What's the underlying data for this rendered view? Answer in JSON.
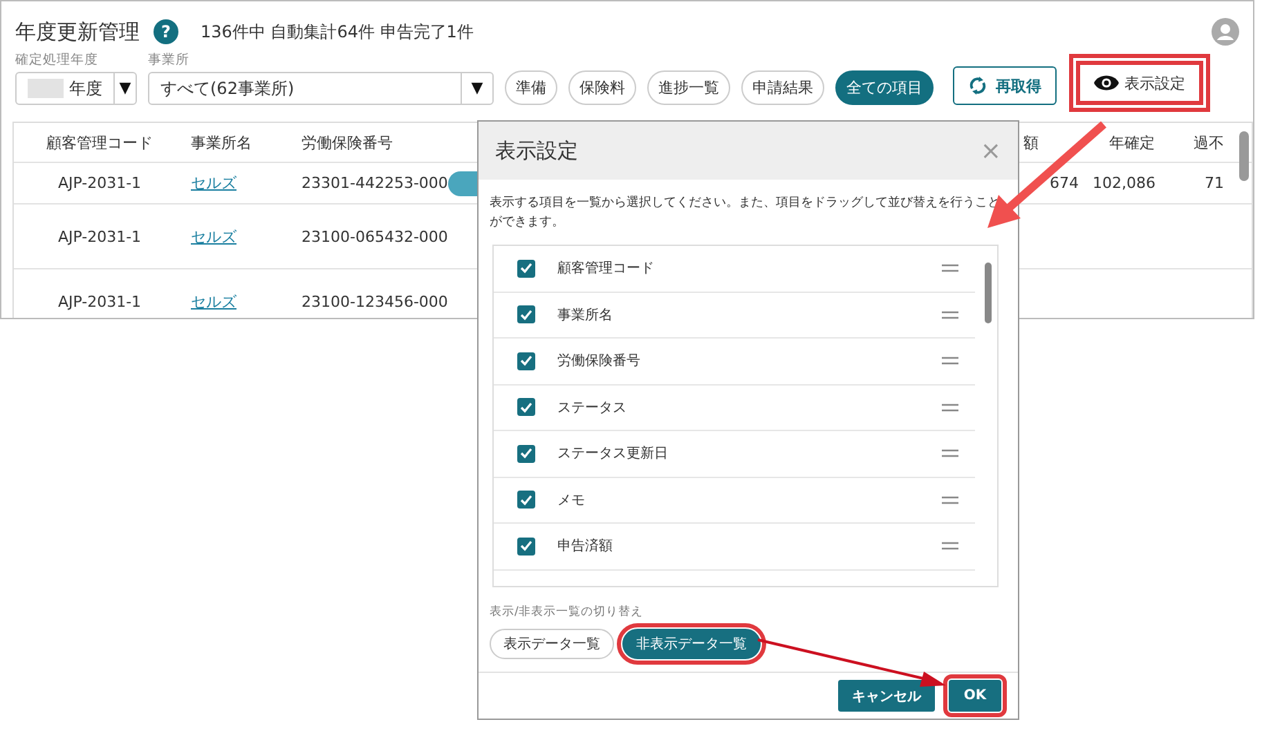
{
  "page": {
    "title": "年度更新管理",
    "help_icon": "?",
    "summary": "136件中 自動集計64件 申告完了1件"
  },
  "filters": [
    {
      "label": "確定処理年度",
      "value": "年度",
      "arrow": "▼",
      "redacted": true
    },
    {
      "label": "事業所",
      "value": "すべて(62事業所)",
      "arrow": "▼",
      "redacted": false
    }
  ],
  "view_buttons": [
    {
      "label": "準備",
      "selected": false
    },
    {
      "label": "保険料",
      "selected": false
    },
    {
      "label": "進捗一覧",
      "selected": false
    },
    {
      "label": "申請結果",
      "selected": false
    },
    {
      "label": "全ての項目",
      "selected": true
    }
  ],
  "reload_button": {
    "label": "再取得",
    "highlighted": false
  },
  "settings_button": {
    "label": "表示設定",
    "highlighted": true
  },
  "table": {
    "columns": [
      "顧客管理コード",
      "事業所名",
      "労働保険番号"
    ],
    "right_columns": [
      "額",
      "年確定",
      "過不"
    ],
    "rows": [
      {
        "cells": [
          "AJP-2031-1",
          "セルズ",
          "23301-442253-000"
        ],
        "status_pill": true,
        "right_cells": [
          "674",
          "102,086",
          "71"
        ]
      },
      {
        "cells": [
          "AJP-2031-1",
          "セルズ",
          "23100-065432-000"
        ],
        "status_pill": false,
        "right_cells": []
      },
      {
        "cells": [
          "AJP-2031-1",
          "セルズ",
          "23100-123456-000"
        ],
        "status_pill": false,
        "right_cells": []
      }
    ]
  },
  "dialog": {
    "title": "表示設定",
    "close": "×",
    "description": "表示する項目を一覧から選択してください。また、項目をドラッグして並び替えを行うことができます。",
    "items": [
      {
        "label": "顧客管理コード",
        "checked": true
      },
      {
        "label": "事業所名",
        "checked": true
      },
      {
        "label": "労働保険番号",
        "checked": true
      },
      {
        "label": "ステータス",
        "checked": true
      },
      {
        "label": "ステータス更新日",
        "checked": true
      },
      {
        "label": "メモ",
        "checked": true
      },
      {
        "label": "申告済額",
        "checked": true
      }
    ],
    "toggle_label": "表示/非表示一覧の切り替え",
    "toggles": [
      {
        "label": "表示データ一覧",
        "selected": false,
        "highlighted": false
      },
      {
        "label": "非表示データ一覧",
        "selected": true,
        "highlighted": true
      }
    ],
    "buttons": [
      {
        "label": "キャンセル",
        "highlighted": false
      },
      {
        "label": "OK",
        "highlighted": true
      }
    ]
  }
}
